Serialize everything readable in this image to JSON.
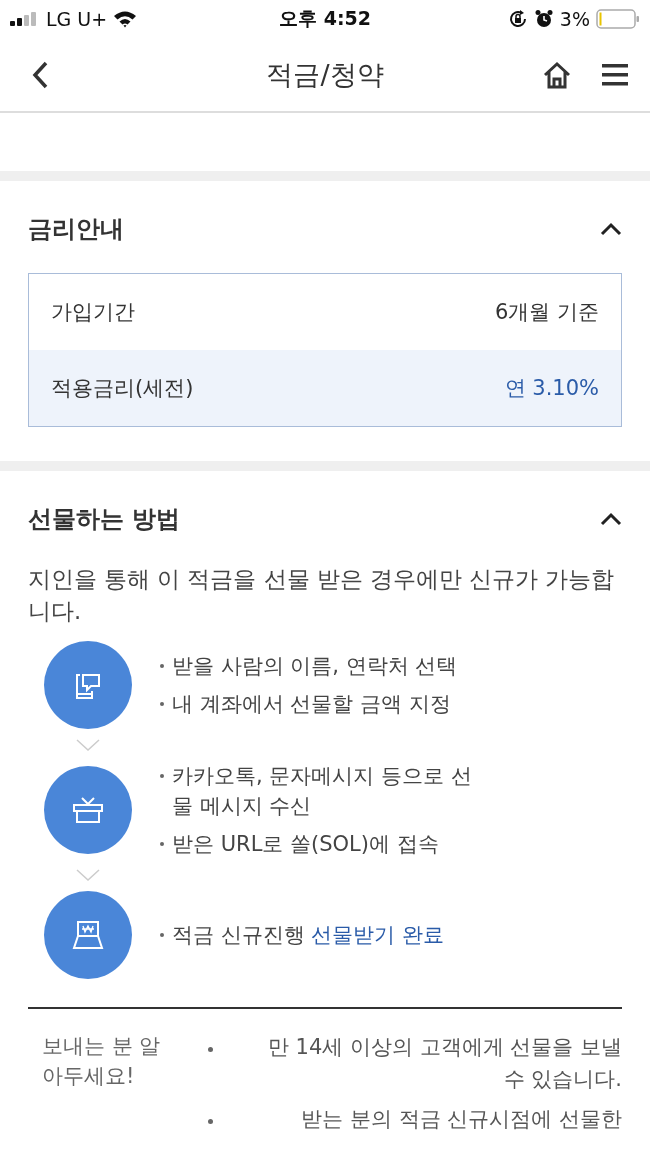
{
  "status_bar": {
    "carrier": "LG U+",
    "time": "오후 4:52",
    "battery": "3%"
  },
  "header": {
    "title": "적금/청약"
  },
  "rate_section": {
    "title": "금리안내",
    "expanded": true,
    "rows": [
      {
        "label": "가입기간",
        "value": "6개월 기준",
        "kind": "plain"
      },
      {
        "label": "적용금리(세전)",
        "value": "연 3.10%",
        "kind": "emphasis"
      }
    ]
  },
  "gift_section": {
    "title": "선물하는 방법",
    "expanded": true,
    "intro": "지인을 통해 이 적금을 선물 받은 경우에만 신규가 가능합니다.",
    "steps": [
      {
        "kind": "phone",
        "bullets": [
          [
            {
              "text": "받을 사람의 이름, 연락처 선택",
              "accent": false
            }
          ],
          [
            {
              "text": "내 계좌에서 선물할 금액 지정",
              "accent": false
            }
          ]
        ]
      },
      {
        "kind": "gift",
        "bullets": [
          [
            {
              "text": "카카오톡, 문자메시지 등으로 선물 메시지 수신",
              "accent": false
            }
          ],
          [
            {
              "text": "받은 URL로 쏠(SOL)에 접속",
              "accent": false
            }
          ]
        ]
      },
      {
        "kind": "atm",
        "bullets": [
          [
            {
              "text": "적금 신규진행 ",
              "accent": false
            },
            {
              "text": "선물받기 완료",
              "accent": true
            }
          ]
        ]
      }
    ]
  },
  "notice": {
    "title": "보내는 분 알아두세요!",
    "items": [
      "만 14세 이상의 고객에게 선물을 보낼 수 있습니다.",
      "받는 분의 적금 신규시점에 선물한"
    ]
  }
}
